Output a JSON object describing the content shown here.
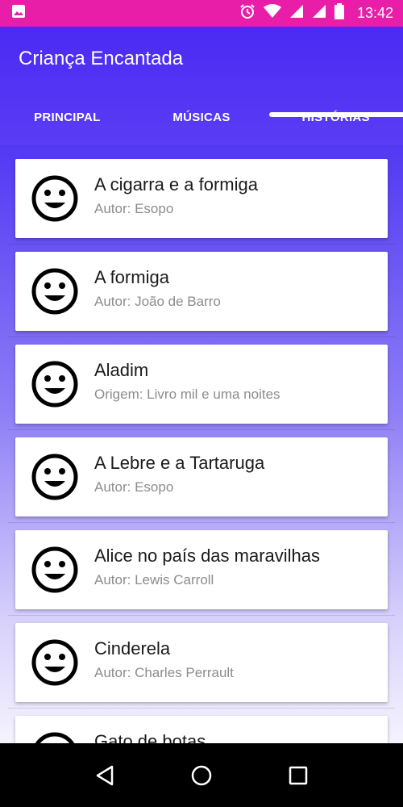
{
  "status_bar": {
    "time": "13:42",
    "icons": [
      "image-icon",
      "alarm-icon",
      "wifi-icon",
      "signal-icon",
      "signal-icon",
      "battery-icon"
    ]
  },
  "app": {
    "title": "Criança Encantada"
  },
  "tabs": [
    {
      "label": "PRINCIPAL",
      "selected": false
    },
    {
      "label": "MÚSICAS",
      "selected": false
    },
    {
      "label": "HISTÓRIAS",
      "selected": true
    }
  ],
  "stories": [
    {
      "title": "A cigarra e a formiga",
      "subtitle": "Autor: Esopo",
      "icon": "smiley-icon"
    },
    {
      "title": "A formiga",
      "subtitle": "Autor: João de Barro",
      "icon": "smiley-icon"
    },
    {
      "title": "Aladim",
      "subtitle": "Origem: Livro mil e uma noites",
      "icon": "smiley-icon"
    },
    {
      "title": "A Lebre e a Tartaruga",
      "subtitle": "Autor: Esopo",
      "icon": "smiley-icon"
    },
    {
      "title": "Alice no país das maravilhas",
      "subtitle": "Autor: Lewis Carroll",
      "icon": "smiley-icon"
    },
    {
      "title": "Cinderela",
      "subtitle": "Autor: Charles Perrault",
      "icon": "smiley-icon"
    },
    {
      "title": "Gato de botas",
      "subtitle": "",
      "icon": "smiley-icon"
    }
  ],
  "colors": {
    "status_bar": "#e91ea8",
    "app_bar": "#4b2af3",
    "nav_bar": "#000000"
  },
  "nav": {
    "icons": [
      "back-icon",
      "home-icon",
      "recents-icon"
    ]
  }
}
